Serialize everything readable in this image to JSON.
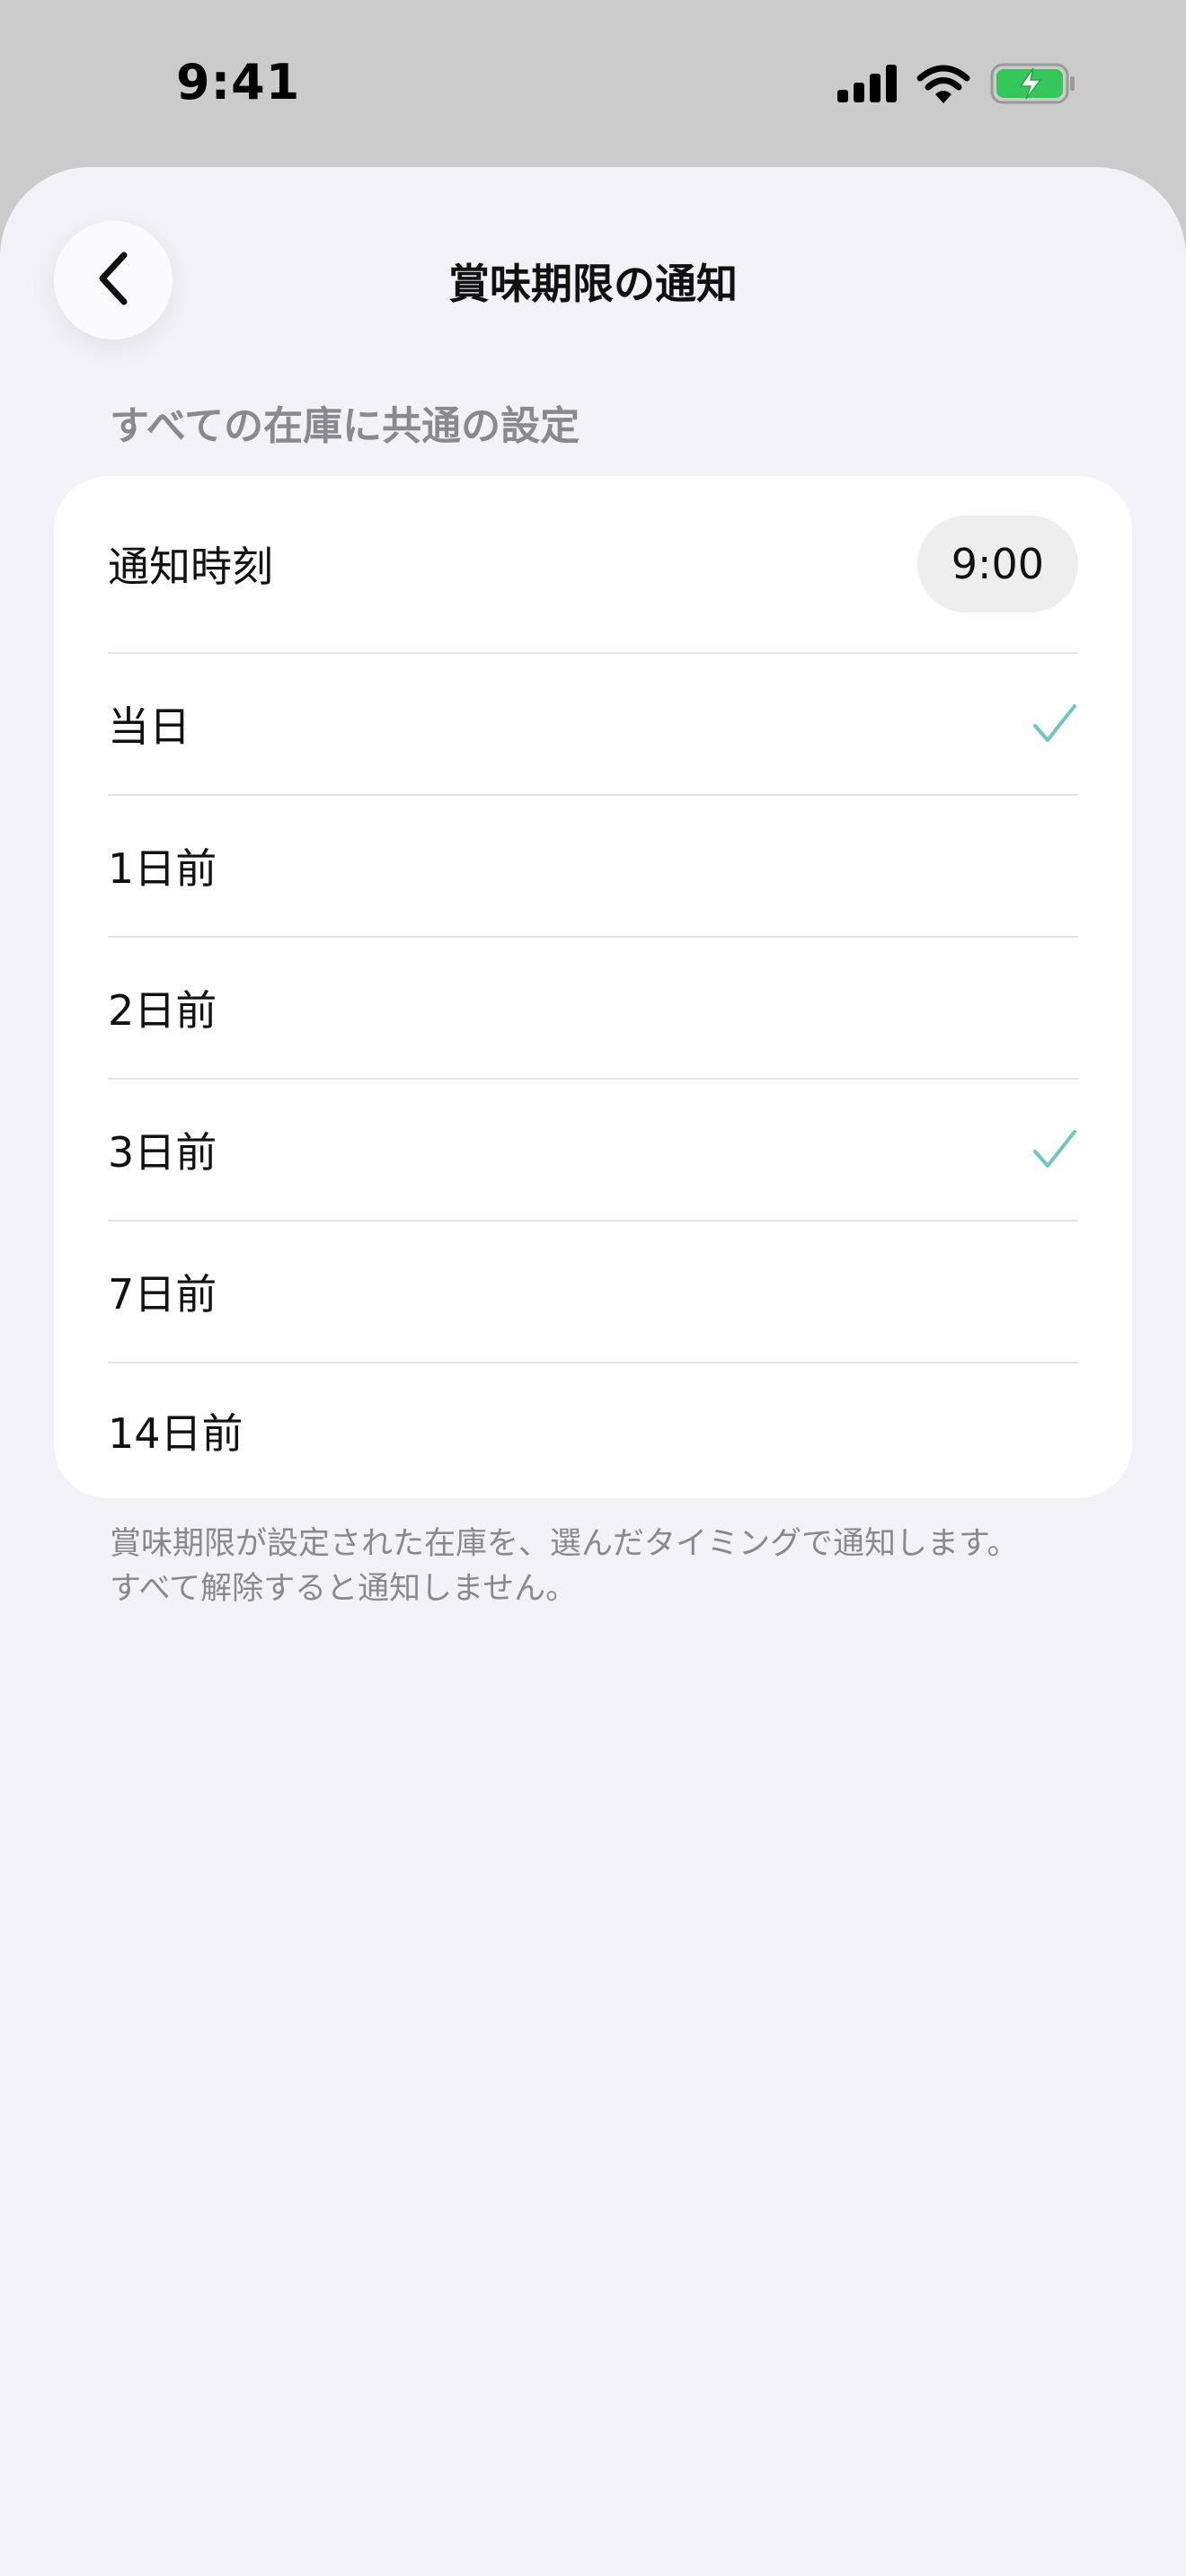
{
  "status_bar": {
    "time": "9:41",
    "icons": [
      "signal-icon",
      "wifi-icon",
      "battery-charging-icon"
    ],
    "battery_color": "#34c759"
  },
  "nav": {
    "back_icon": "chevron-left-icon",
    "title": "賞味期限の通知"
  },
  "section": {
    "header": "すべての在庫に共通の設定"
  },
  "settings": {
    "time_row": {
      "label": "通知時刻",
      "value": "9:00"
    },
    "options": [
      {
        "label": "当日",
        "checked": true
      },
      {
        "label": "1日前",
        "checked": false
      },
      {
        "label": "2日前",
        "checked": false
      },
      {
        "label": "3日前",
        "checked": true
      },
      {
        "label": "7日前",
        "checked": false
      },
      {
        "label": "14日前",
        "checked": false
      }
    ],
    "check_color": "#6fc7c0"
  },
  "footer": {
    "line1": "賞味期限が設定された在庫を、選んだタイミングで通知します。",
    "line2": "すべて解除すると通知しません。"
  }
}
